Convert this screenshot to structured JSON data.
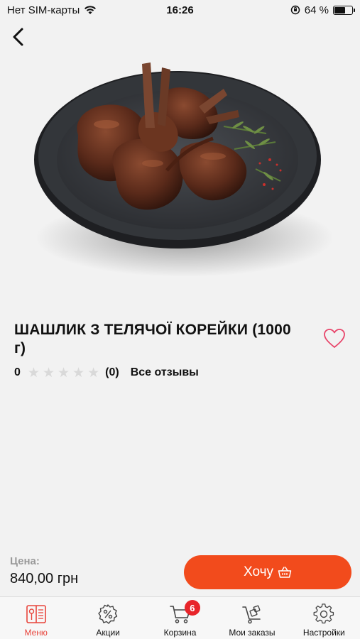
{
  "status_bar": {
    "carrier": "Нет SIM-карты",
    "time": "16:26",
    "battery": "64 %",
    "battery_level": 0.64
  },
  "product": {
    "title": "ШАШЛИК З ТЕЛЯЧОЇ КОРЕЙКИ (1000 г)",
    "rating_value": "0",
    "rating_stars": 0,
    "rating_max": 5,
    "reviews_count": "(0)",
    "all_reviews_label": "Все отзывы"
  },
  "order": {
    "price_label": "Цена:",
    "price_value": "840,00 грн",
    "button_label": "Хочу"
  },
  "tabs": [
    {
      "label": "Меню",
      "icon": "menu-book-icon",
      "active": true
    },
    {
      "label": "Акции",
      "icon": "discount-icon",
      "active": false
    },
    {
      "label": "Корзина",
      "icon": "cart-icon",
      "active": false,
      "badge": "6"
    },
    {
      "label": "Мои заказы",
      "icon": "trolley-icon",
      "active": false
    },
    {
      "label": "Настройки",
      "icon": "gear-icon",
      "active": false
    }
  ],
  "colors": {
    "accent": "#f24b1c",
    "active_tab": "#e8453c",
    "badge": "#e8252a",
    "heart": "#e8456a"
  }
}
